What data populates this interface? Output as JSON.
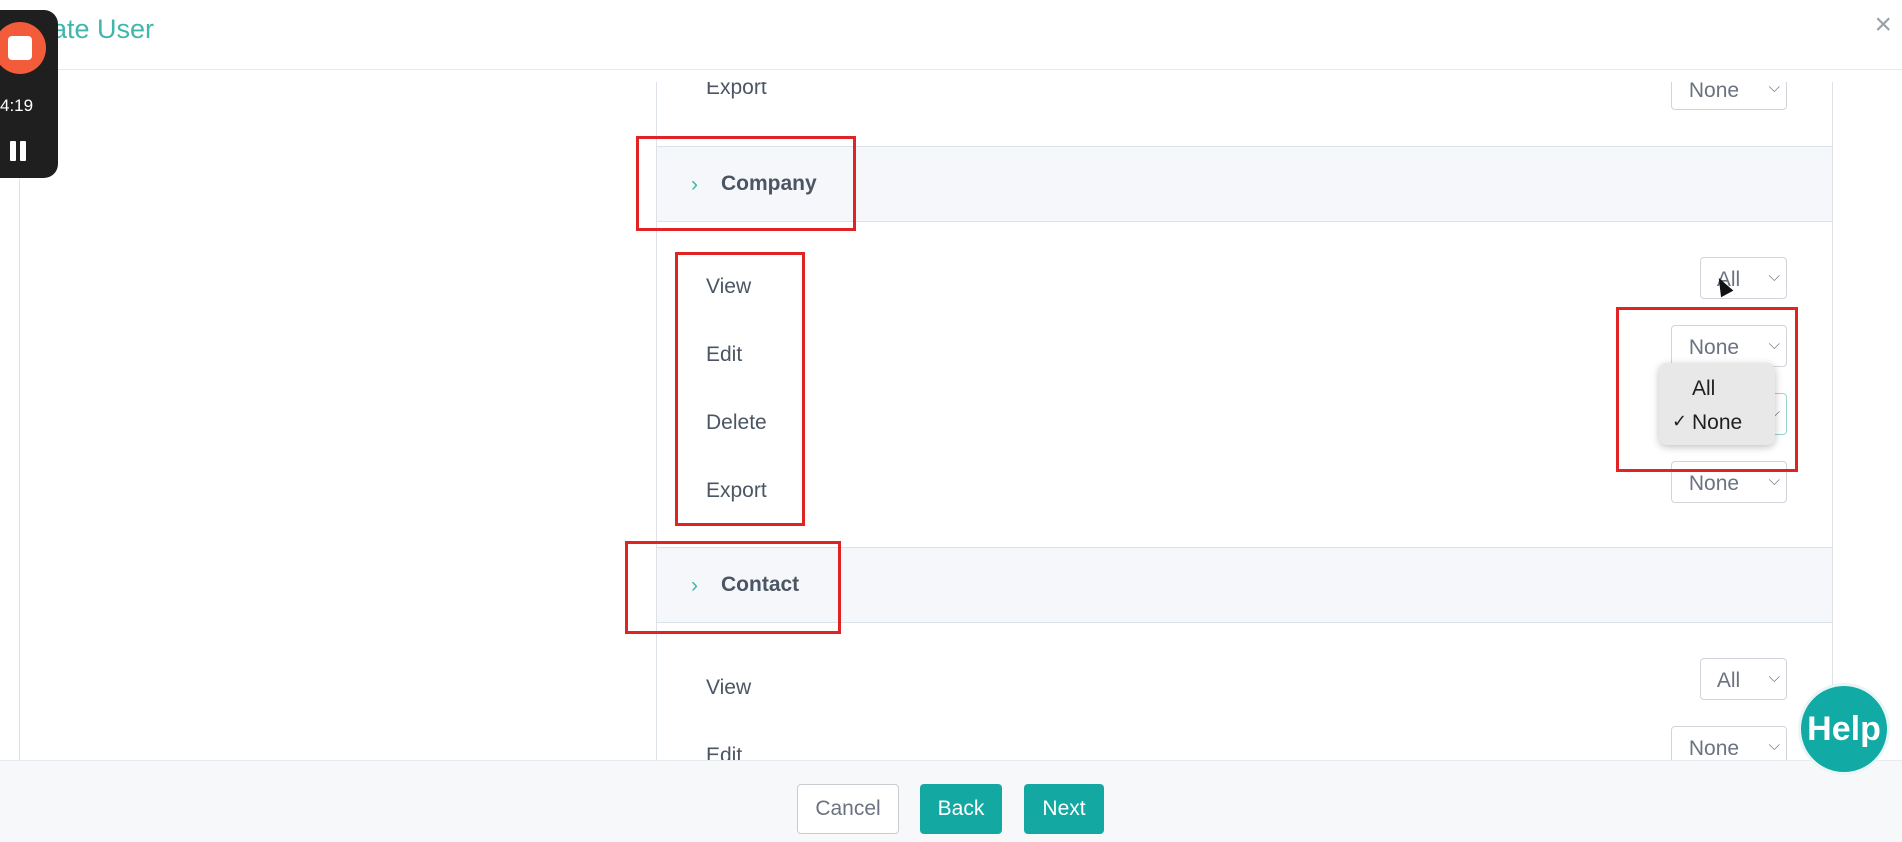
{
  "header": {
    "title": "ate User",
    "close_label": "×"
  },
  "recorder": {
    "elapsed": "4:19"
  },
  "colors": {
    "accent": "#3fb7ad",
    "button": "#13a8a2",
    "highlight": "#e02424"
  },
  "rows": {
    "top_export": {
      "label": "Export",
      "value": "None"
    },
    "company": {
      "title": "Company",
      "view": {
        "label": "View",
        "value": "All"
      },
      "edit": {
        "label": "Edit",
        "value": "None"
      },
      "delete": {
        "label": "Delete"
      },
      "export": {
        "label": "Export",
        "value": "None"
      }
    },
    "contact": {
      "title": "Contact",
      "view": {
        "label": "View",
        "value": "All"
      },
      "edit": {
        "label": "Edit",
        "value": "None"
      }
    }
  },
  "dropdown": {
    "options": [
      {
        "label": "All",
        "checked": false
      },
      {
        "label": "None",
        "checked": true,
        "check_glyph": "✓"
      }
    ]
  },
  "footer": {
    "cancel": "Cancel",
    "back": "Back",
    "next": "Next"
  },
  "help": {
    "label": "Help"
  }
}
